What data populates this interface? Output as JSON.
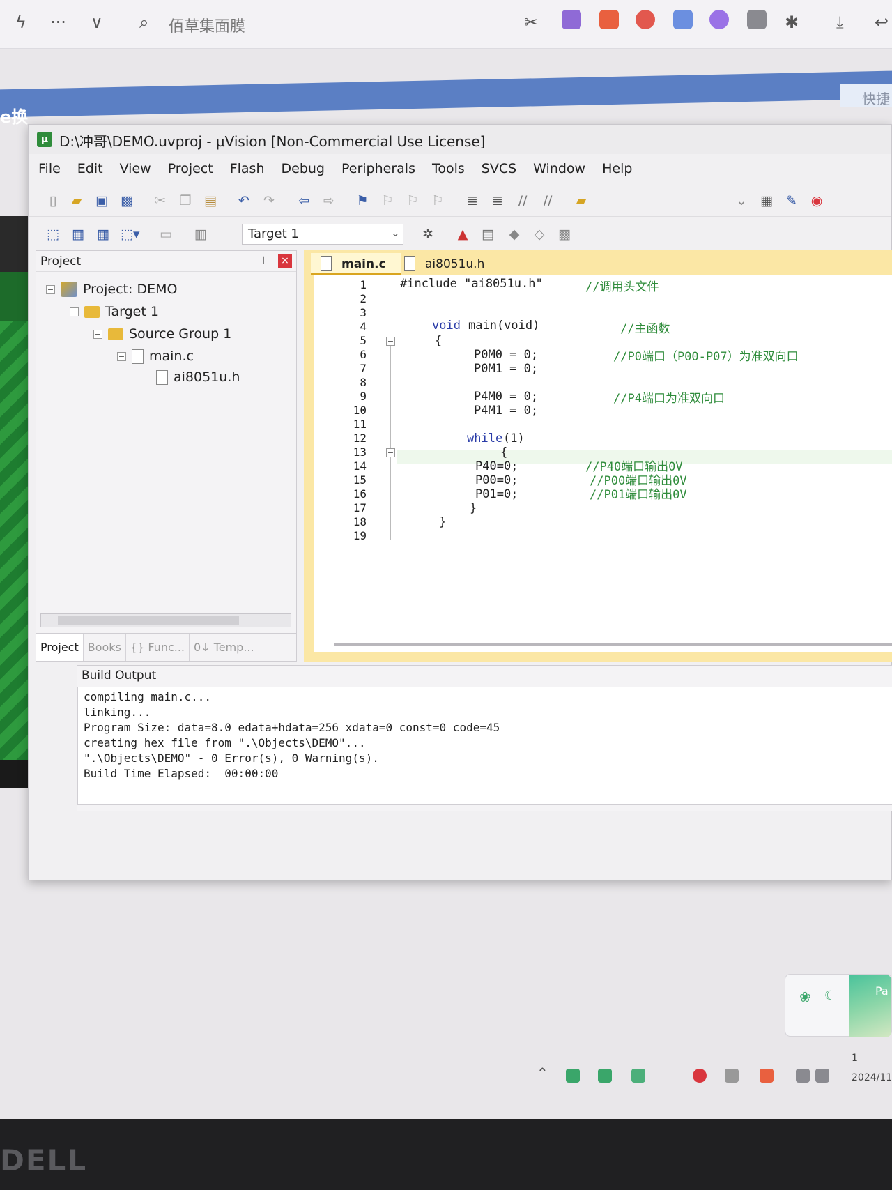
{
  "browser": {
    "search_text": "佰草集面膜",
    "more_label": "···",
    "chevron_label": "∨"
  },
  "band": {
    "left_text": "e换",
    "right_text": "快捷"
  },
  "window": {
    "title": "D:\\冲哥\\DEMO.uvproj - µVision  [Non-Commercial Use License]"
  },
  "menu": [
    "File",
    "Edit",
    "View",
    "Project",
    "Flash",
    "Debug",
    "Peripherals",
    "Tools",
    "SVCS",
    "Window",
    "Help"
  ],
  "toolbar2": {
    "target": "Target 1"
  },
  "project": {
    "title": "Project",
    "root": "Project: DEMO",
    "target": "Target 1",
    "group": "Source Group 1",
    "file1": "main.c",
    "file2": "ai8051u.h",
    "tabs": [
      "Project",
      "Books",
      "{} Func...",
      "0↓ Temp..."
    ]
  },
  "editor": {
    "tabs": [
      "main.c",
      "ai8051u.h"
    ],
    "line_numbers": [
      "1",
      "2",
      "3",
      "4",
      "5",
      "6",
      "7",
      "8",
      "9",
      "10",
      "11",
      "12",
      "13",
      "14",
      "15",
      "16",
      "17",
      "18",
      "19"
    ],
    "lines": {
      "l1_code": "#include \"ai8051u.h\"",
      "l1_comment": "//调用头文件",
      "l4_kw": "void",
      "l4_code": "main(void)",
      "l4_comment": "//主函数",
      "l5_code": "{",
      "l6_code": "P0M0 = 0;",
      "l6_comment": "//P0端口（P00-P07）为准双向口",
      "l7_code": "P0M1 = 0;",
      "l9_code": "P4M0 = 0;",
      "l9_comment": "//P4端口为准双向口",
      "l10_code": "P4M1 = 0;",
      "l12_kw": "while",
      "l12_code": "(1)",
      "l13_code": "{",
      "l14_code": "P40=0;",
      "l14_comment": "//P40端口输出0V",
      "l15_code": "P00=0;",
      "l15_comment": "//P00端口输出0V",
      "l16_code": "P01=0;",
      "l16_comment": "//P01端口输出0V",
      "l17_code": "}",
      "l18_code": "}"
    }
  },
  "build": {
    "title": "Build Output",
    "lines": [
      "compiling main.c...",
      "linking...",
      "Program Size: data=8.0 edata+hdata=256 xdata=0 const=0 code=45",
      "creating hex file from \".\\Objects\\DEMO\"...",
      "\".\\Objects\\DEMO\" - 0 Error(s), 0 Warning(s).",
      "Build Time Elapsed:  00:00:00"
    ]
  },
  "tray": {
    "time": "1",
    "date": "2024/11"
  },
  "widget": {
    "text": "Pa"
  },
  "bezel": {
    "brand": "DELL"
  },
  "colors": {
    "editor_tab_bg": "#fbe7a5",
    "keyword": "#2a3ca8",
    "comment": "#2f8c3b",
    "close_red": "#d9363e"
  }
}
